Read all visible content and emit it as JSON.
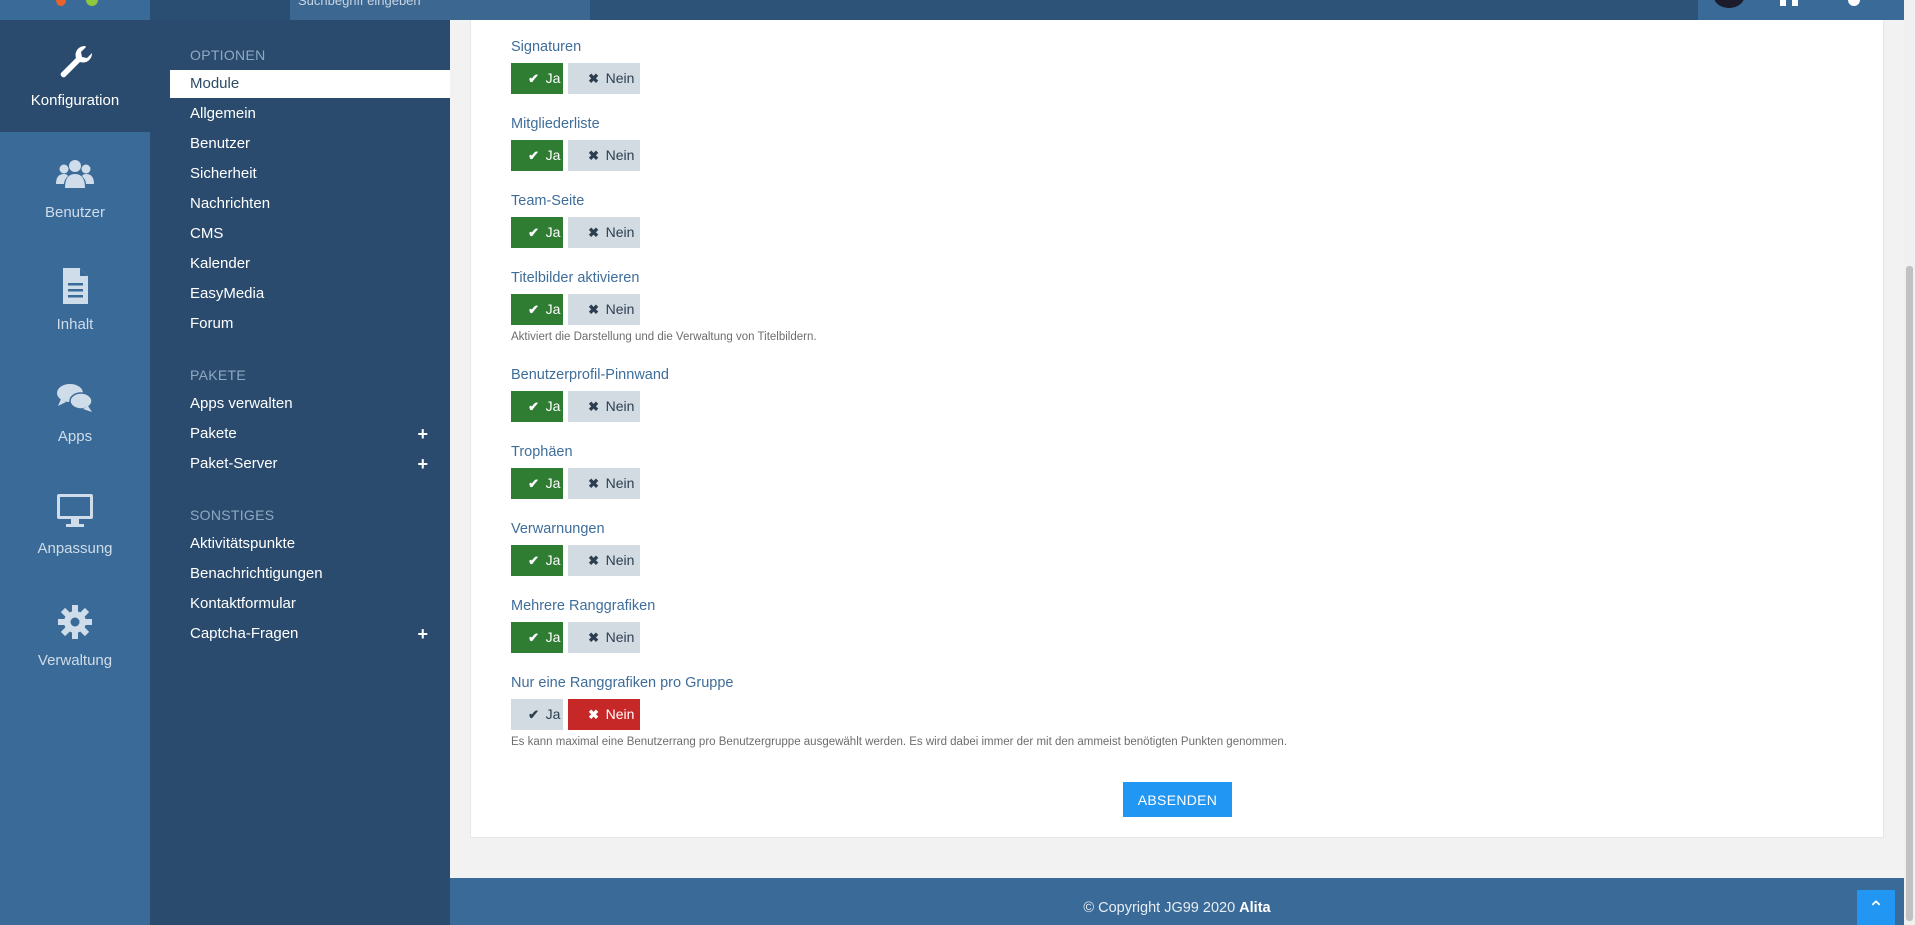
{
  "topbar": {
    "search_placeholder": "Suchbegriff eingeben"
  },
  "iconbar": [
    {
      "label": "Konfiguration",
      "icon": "wrench-icon",
      "active": true
    },
    {
      "label": "Benutzer",
      "icon": "users-icon",
      "active": false
    },
    {
      "label": "Inhalt",
      "icon": "document-icon",
      "active": false
    },
    {
      "label": "Apps",
      "icon": "comments-icon",
      "active": false
    },
    {
      "label": "Anpassung",
      "icon": "monitor-icon",
      "active": false
    },
    {
      "label": "Verwaltung",
      "icon": "gear-icon",
      "active": false
    }
  ],
  "submenu": {
    "section1": "OPTIONEN",
    "section2": "PAKETE",
    "section3": "SONSTIGES",
    "optionen": [
      "Module",
      "Allgemein",
      "Benutzer",
      "Sicherheit",
      "Nachrichten",
      "CMS",
      "Kalender",
      "EasyMedia",
      "Forum"
    ],
    "pakete": [
      "Apps verwalten",
      "Pakete",
      "Paket-Server"
    ],
    "sonstiges": [
      "Aktivitätspunkte",
      "Benachrichtigungen",
      "Kontaktformular",
      "Captcha-Fragen"
    ],
    "plus": "+"
  },
  "options": [
    {
      "label": "Signaturen",
      "value": "ja"
    },
    {
      "label": "Mitgliederliste",
      "value": "ja"
    },
    {
      "label": "Team-Seite",
      "value": "ja"
    },
    {
      "label": "Titelbilder aktivieren",
      "value": "ja",
      "help": "Aktiviert die Darstellung und die Verwaltung von Titelbildern."
    },
    {
      "label": "Benutzerprofil-Pinnwand",
      "value": "ja"
    },
    {
      "label": "Trophäen",
      "value": "ja"
    },
    {
      "label": "Verwarnungen",
      "value": "ja"
    },
    {
      "label": "Mehrere Ranggrafiken",
      "value": "ja"
    },
    {
      "label": "Nur eine Ranggrafiken pro Gruppe",
      "value": "nein",
      "help": "Es kann maximal eine Benutzerrang pro Benutzergruppe ausgewählt werden. Es wird dabei immer der mit den ammeist benötigten Punkten genommen."
    }
  ],
  "buttons": {
    "ja": "Ja",
    "nein": "Nein",
    "check_glyph": "✔",
    "cross_glyph": "✖",
    "submit": "ABSENDEN"
  },
  "footer": {
    "copyright": "© Copyright JG99 2020",
    "brand": "Alita",
    "totop_glyph": "⌃"
  },
  "colors": {
    "active_ja": "#2f7d32",
    "active_nein": "#c62828",
    "inactive": "#d3dbe2",
    "submit": "#2196f3"
  }
}
